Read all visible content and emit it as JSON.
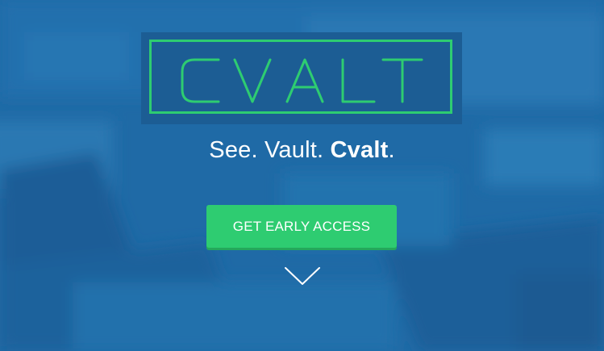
{
  "brand": {
    "logo_text": "CVALT",
    "accent_color": "#2ecc71",
    "background_color": "#1f6aa6"
  },
  "tagline": {
    "part1": "See.",
    "part2": "Vault.",
    "part3": "Cvalt",
    "part4": "."
  },
  "cta": {
    "label": "GET EARLY ACCESS"
  },
  "scroll": {
    "icon": "chevron-down-icon"
  }
}
